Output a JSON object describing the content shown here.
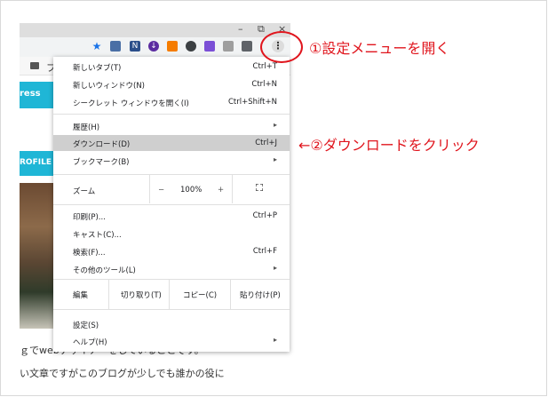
{
  "window": {
    "minimize": "–",
    "restore": "⧉",
    "close": "×"
  },
  "toolbar": {
    "icons": [
      "star-icon",
      "screenshot-icon",
      "n-extension-icon",
      "download-extension-icon",
      "orange-extension-icon",
      "chat-extension-icon",
      "purple-extension-icon",
      "grey-extension-icon",
      "puzzle-icon",
      "kebab-menu-icon"
    ],
    "kebab_glyph": "⋮"
  },
  "bookmarks": {
    "folder_label": "フ"
  },
  "page": {
    "banner_text": "ress",
    "profile_text": "ROFILE",
    "text1": "ｇでwebデザイナーをしていることです。",
    "text2": "い文章ですがこのブログが少しでも誰かの役に"
  },
  "menu": {
    "new_tab": {
      "label": "新しいタブ(T)",
      "shortcut": "Ctrl+T"
    },
    "new_window": {
      "label": "新しいウィンドウ(N)",
      "shortcut": "Ctrl+N"
    },
    "incognito": {
      "label": "シークレット ウィンドウを開く(I)",
      "shortcut": "Ctrl+Shift+N"
    },
    "history": {
      "label": "履歴(H)",
      "arrow": "▸"
    },
    "downloads": {
      "label": "ダウンロード(D)",
      "shortcut": "Ctrl+J"
    },
    "bookmarks": {
      "label": "ブックマーク(B)",
      "arrow": "▸"
    },
    "zoom": {
      "label": "ズーム",
      "minus": "−",
      "value": "100%",
      "plus": "+"
    },
    "print": {
      "label": "印刷(P)...",
      "shortcut": "Ctrl+P"
    },
    "cast": {
      "label": "キャスト(C)..."
    },
    "find": {
      "label": "検索(F)...",
      "shortcut": "Ctrl+F"
    },
    "more_tools": {
      "label": "その他のツール(L)",
      "arrow": "▸"
    },
    "edit": {
      "label": "編集",
      "cut": "切り取り(T)",
      "copy": "コピー(C)",
      "paste": "貼り付け(P)"
    },
    "settings": {
      "label": "設定(S)"
    },
    "help": {
      "label": "ヘルプ(H)",
      "arrow": "▸"
    }
  },
  "annotations": {
    "step1": "①設定メニューを開く",
    "step2": "←②ダウンロードをクリック",
    "color": "#e0151d"
  }
}
